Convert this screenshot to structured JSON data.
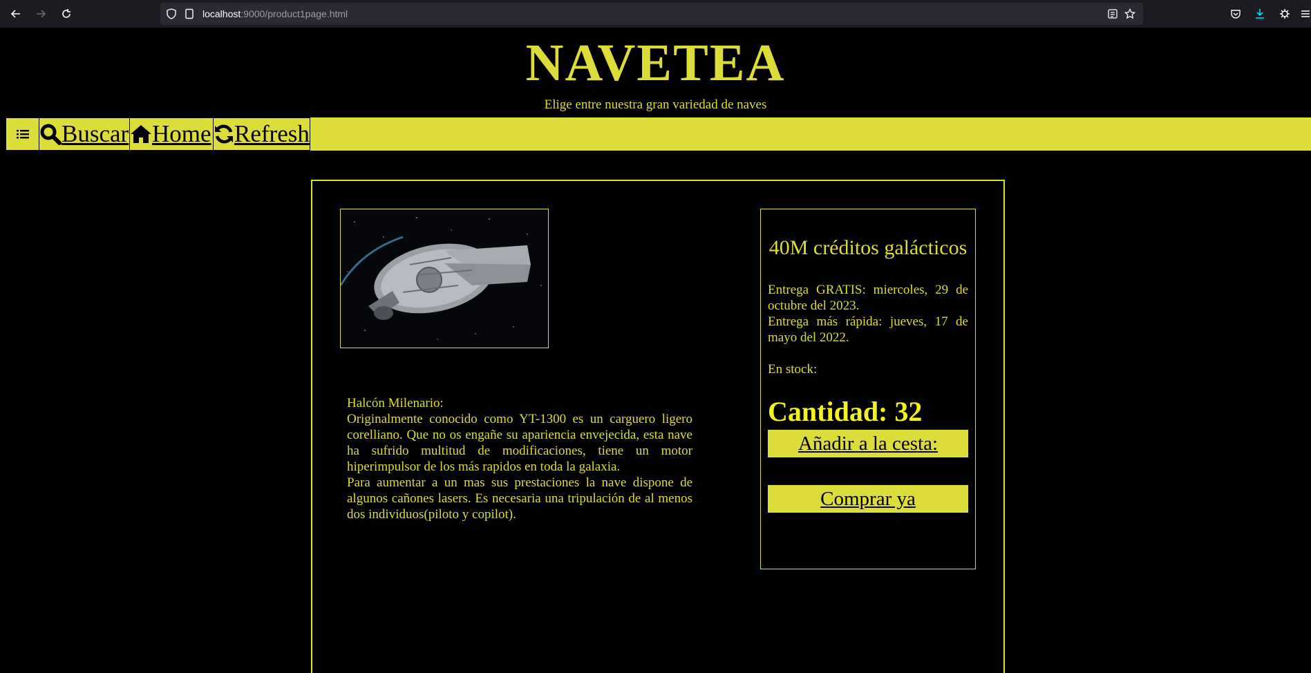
{
  "browser": {
    "url_host": "localhost",
    "url_rest": ":9000/product1page.html",
    "icons": [
      "back-icon",
      "forward-icon",
      "reload-icon",
      "shield-icon",
      "page-icon",
      "reader-view-icon",
      "bookmark-star-icon",
      "pocket-icon",
      "download-icon",
      "extensions-icon",
      "menu-icon"
    ]
  },
  "header": {
    "title": "NAVETEA",
    "subtitle": "Elige entre nuestra gran variedad de naves"
  },
  "nav": {
    "items": [
      {
        "icon": "list-icon",
        "label": ""
      },
      {
        "icon": "search-icon",
        "label": "Buscar"
      },
      {
        "icon": "home-icon",
        "label": "Home"
      },
      {
        "icon": "refresh-icon",
        "label": "Refresh"
      }
    ]
  },
  "product": {
    "image_alt": "Halcón Milenario",
    "name_line": "Halcón Milenario:",
    "description_1": "Originalmente conocido como YT-1300 es un carguero ligero corelliano. Que no os engañe su apariencia envejecida, esta nave ha sufrido multitud de modificaciones, tiene un motor hiperimpulsor de los más rapidos en toda la galaxia.",
    "description_2": "Para aumentar a un mas sus prestaciones la nave dispone de algunos cañones lasers. Es necesaria una tripulación de al menos dos individuos(piloto y copilot).",
    "price": "40M créditos galácticos",
    "delivery_free": "Entrega GRATIS: miercoles, 29 de octubre del 2023.",
    "delivery_fast": "Entrega más rápida: jueves, 17 de mayo del 2022.",
    "stock": "En stock:",
    "quantity": "Cantidad: 32",
    "add_to_cart": "Añadir a la cesta:",
    "buy_now": "Comprar ya"
  },
  "colors": {
    "accent": "#dcdc3a",
    "background": "#000000"
  }
}
